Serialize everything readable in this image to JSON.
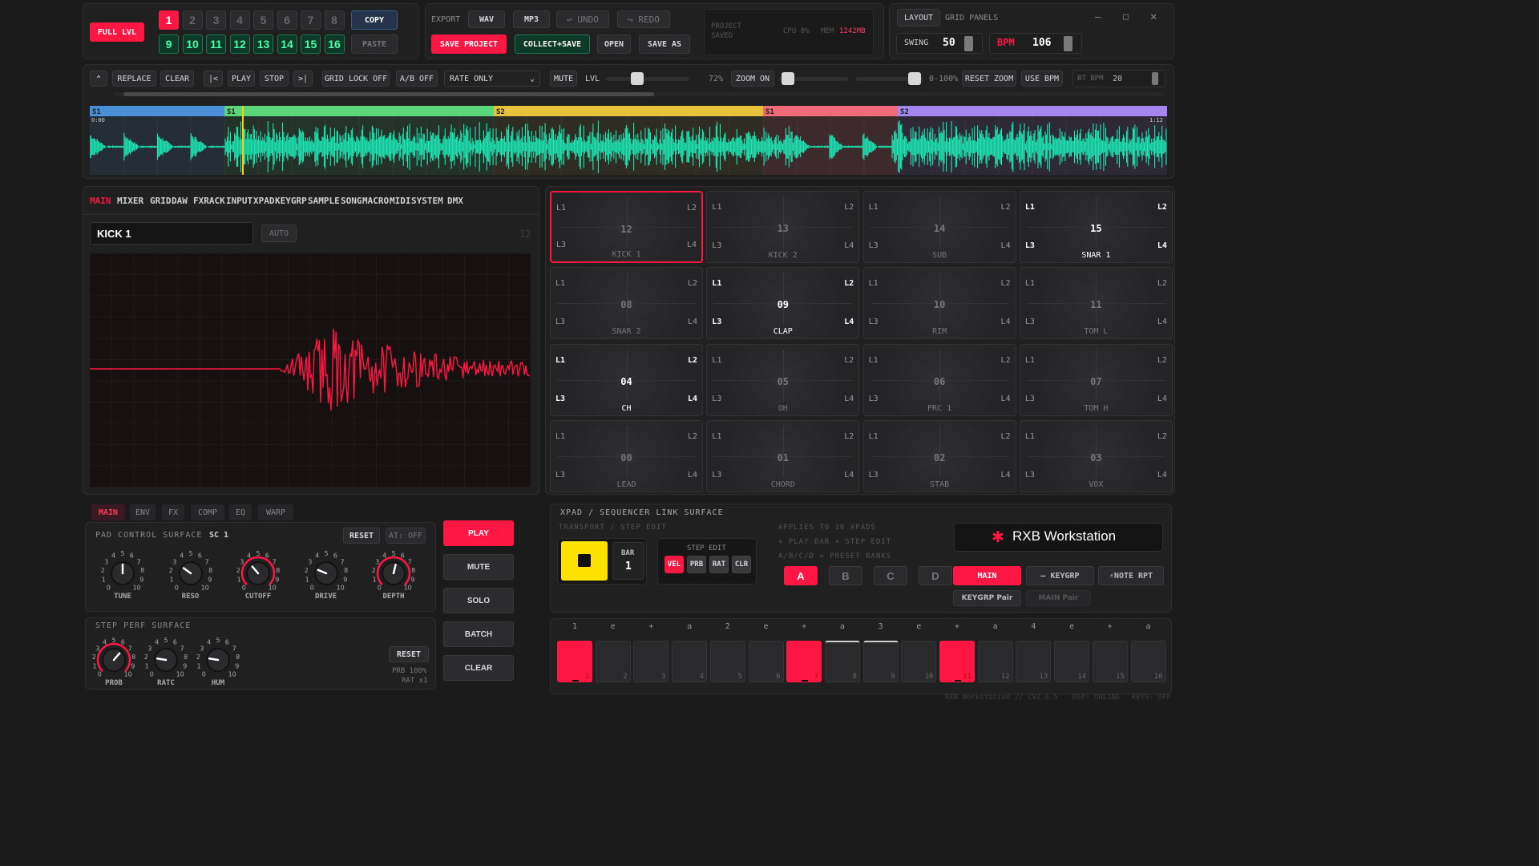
{
  "header": {
    "full_lvl": "FULL LVL",
    "banks_top": [
      "1",
      "2",
      "3",
      "4",
      "5",
      "6",
      "7",
      "8"
    ],
    "banks_bottom": [
      "9",
      "10",
      "11",
      "12",
      "13",
      "14",
      "15",
      "16"
    ],
    "copy": "COPY",
    "paste": "PASTE",
    "export_label": "EXPORT",
    "wav": "WAV",
    "mp3": "MP3",
    "undo": "UNDO",
    "redo": "REDO",
    "save_project": "SAVE PROJECT",
    "collect_save": "COLLECT+SAVE",
    "open": "OPEN",
    "save_as": "SAVE AS",
    "project_status": "PROJECT SAVED",
    "cpu": "CPU 8%",
    "mem_label": "MEM",
    "mem_value": "1242MB",
    "layout": "LAYOUT",
    "grid_panels": "GRID PANELS",
    "swing_label": "SWING",
    "swing_value": "50",
    "bpm_label": "BPM",
    "bpm_value": "106"
  },
  "transport": {
    "replace": "REPLACE",
    "clear": "CLEAR",
    "prev": "|<",
    "play": "PLAY",
    "stop": "STOP",
    "next": ">|",
    "grid_lock": "GRID LOCK OFF",
    "ab": "A/B OFF",
    "rate_select": "RATE ONLY",
    "mute": "MUTE",
    "lvl": "LVL",
    "lvl_pct": "72%",
    "zoom_on": "ZOOM ON",
    "range": "0-100%",
    "reset_zoom": "RESET ZOOM",
    "use_bpm": "USE BPM",
    "bt_bpm_label": "BT BPM",
    "bt_bpm_value": "20"
  },
  "timeline": {
    "sections": [
      "S1",
      "S1",
      "S2",
      "S1",
      "S2"
    ],
    "section_colors": [
      "#4a90d9",
      "#5cd67a",
      "#e8c23a",
      "#f06a7a",
      "#a585f0"
    ],
    "start_time": "0:00",
    "end_time": "1:12",
    "wave_color": "#1de9b6"
  },
  "editor": {
    "tabs": [
      "MAIN",
      "MIXER",
      "GRID",
      "DAW",
      "FXRACK",
      "INPUT",
      "XPAD",
      "KEYGRP",
      "SAMPLE",
      "SONG",
      "MACRO",
      "MIDI",
      "SYSTEM",
      "DMX"
    ],
    "sample_name": "KICK 1",
    "auto": "AUTO",
    "pad_number": "12",
    "wave_color": "#ff1744"
  },
  "pads": [
    {
      "num": "12",
      "name": "KICK 1",
      "active": false,
      "selected": true
    },
    {
      "num": "13",
      "name": "KICK 2",
      "active": false
    },
    {
      "num": "14",
      "name": "SUB",
      "active": false
    },
    {
      "num": "15",
      "name": "SNAR 1",
      "active": true
    },
    {
      "num": "08",
      "name": "SNAR 2",
      "active": false
    },
    {
      "num": "09",
      "name": "CLAP",
      "active": true
    },
    {
      "num": "10",
      "name": "RIM",
      "active": false
    },
    {
      "num": "11",
      "name": "TOM L",
      "active": false
    },
    {
      "num": "04",
      "name": "CH",
      "active": true
    },
    {
      "num": "05",
      "name": "OH",
      "active": false
    },
    {
      "num": "06",
      "name": "PRC 1",
      "active": false
    },
    {
      "num": "07",
      "name": "TOM H",
      "active": false
    },
    {
      "num": "00",
      "name": "LEAD",
      "active": false
    },
    {
      "num": "01",
      "name": "CHORD",
      "active": false
    },
    {
      "num": "02",
      "name": "STAB",
      "active": false
    },
    {
      "num": "03",
      "name": "VOX",
      "active": false
    }
  ],
  "pad_corners": [
    "L1",
    "L2",
    "L3",
    "L4"
  ],
  "control_tabs": [
    "MAIN",
    "ENV",
    "FX",
    "COMP",
    "EQ",
    "WARP"
  ],
  "pad_control": {
    "title": "PAD CONTROL SURFACE",
    "sc": "SC 1",
    "reset": "RESET",
    "at": "AT: OFF",
    "knobs": [
      {
        "name": "TUNE",
        "value": 0.5,
        "ring": false
      },
      {
        "name": "RESO",
        "value": 0.3,
        "ring": false
      },
      {
        "name": "CUTOFF",
        "value": 0.35,
        "ring": true
      },
      {
        "name": "DRIVE",
        "value": 0.25,
        "ring": false
      },
      {
        "name": "DEPTH",
        "value": 0.55,
        "ring": true
      }
    ],
    "scale": [
      "0",
      "1",
      "2",
      "3",
      "4",
      "5",
      "6",
      "7",
      "8",
      "9",
      "10"
    ]
  },
  "step_perf": {
    "title": "STEP PERF SURFACE",
    "reset": "RESET",
    "prb": "PRB 100%",
    "rat": "RAT x1",
    "knobs": [
      {
        "name": "PROB",
        "value": 0.65,
        "ring": true
      },
      {
        "name": "RATC",
        "value": 0.2,
        "ring": false
      },
      {
        "name": "HUM",
        "value": 0.2,
        "ring": false
      }
    ]
  },
  "actions": [
    "PLAY",
    "MUTE",
    "SOLO",
    "BATCH",
    "CLEAR"
  ],
  "xpad": {
    "title": "XPAD / SEQUENCER LINK SURFACE",
    "subtitle": "TRANSPORT / STEP EDIT",
    "bar_label": "BAR",
    "bar_value": "1",
    "step_edit": "STEP EDIT",
    "step_edit_buttons": [
      "VEL",
      "PRB",
      "RAT",
      "CLR"
    ],
    "info": [
      "APPLIES TO 16 XPADS",
      "+ PLAY BAR + STEP EDIT",
      "A/B/C/D = PRESET BANKS"
    ],
    "banks": [
      "A",
      "B",
      "C",
      "D"
    ],
    "brand": "RXB Workstation",
    "mode_main": "MAIN",
    "mode_keygrp": "KEYGRP",
    "mode_note_rpt": "NOTE RPT",
    "keygrp_pair": "KEYGRP Pair",
    "main_pair": "MAIN Pair"
  },
  "sequencer": {
    "beat_labels": [
      "1",
      "e",
      "+",
      "a",
      "2",
      "e",
      "+",
      "a",
      "3",
      "e",
      "+",
      "a",
      "4",
      "e",
      "+",
      "a"
    ],
    "steps": [
      1,
      0,
      0,
      0,
      0,
      0,
      1,
      0,
      0,
      0,
      1,
      0,
      0,
      0,
      0,
      0
    ],
    "outlined": [
      7,
      8
    ]
  },
  "footer": {
    "version": "RXB Workstation // CV2.6.5",
    "dsp": "DSP: ONLINE",
    "keys": "KEYS: OFF"
  }
}
